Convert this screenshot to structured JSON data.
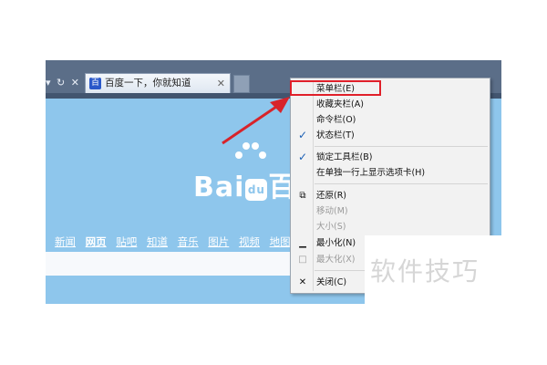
{
  "browser": {
    "nav_buttons": [
      "▾",
      "↻",
      "✕"
    ],
    "tab": {
      "title": "百度一下，你就知道",
      "close": "✕",
      "favicon": "百"
    }
  },
  "page": {
    "logo_left": "Bai",
    "logo_paw": "du",
    "logo_right": "百",
    "nav_links": [
      "新闻",
      "网页",
      "贴吧",
      "知道",
      "音乐",
      "图片",
      "视频",
      "地图"
    ]
  },
  "context_menu": {
    "items": [
      {
        "label": "菜单栏(E)",
        "icon": "",
        "disabled": false
      },
      {
        "label": "收藏夹栏(A)",
        "icon": "",
        "disabled": false
      },
      {
        "label": "命令栏(O)",
        "icon": "",
        "disabled": false
      },
      {
        "label": "状态栏(T)",
        "icon": "✓",
        "disabled": false
      },
      {
        "label": "锁定工具栏(B)",
        "icon": "✓",
        "disabled": false
      },
      {
        "label": "在单独一行上显示选项卡(H)",
        "icon": "",
        "disabled": false
      },
      {
        "label": "还原(R)",
        "icon": "⧉",
        "disabled": false
      },
      {
        "label": "移动(M)",
        "icon": "",
        "disabled": true
      },
      {
        "label": "大小(S)",
        "icon": "",
        "disabled": true
      },
      {
        "label": "最小化(N)",
        "icon": "▁",
        "disabled": false
      },
      {
        "label": "最大化(X)",
        "icon": "□",
        "disabled": true
      },
      {
        "label": "关闭(C)",
        "icon": "✕",
        "disabled": false
      }
    ]
  },
  "watermark": "软件技巧",
  "colors": {
    "highlight": "#e0202a",
    "page_bg": "#8ec6ec",
    "toolbar": "#5b6e88"
  }
}
